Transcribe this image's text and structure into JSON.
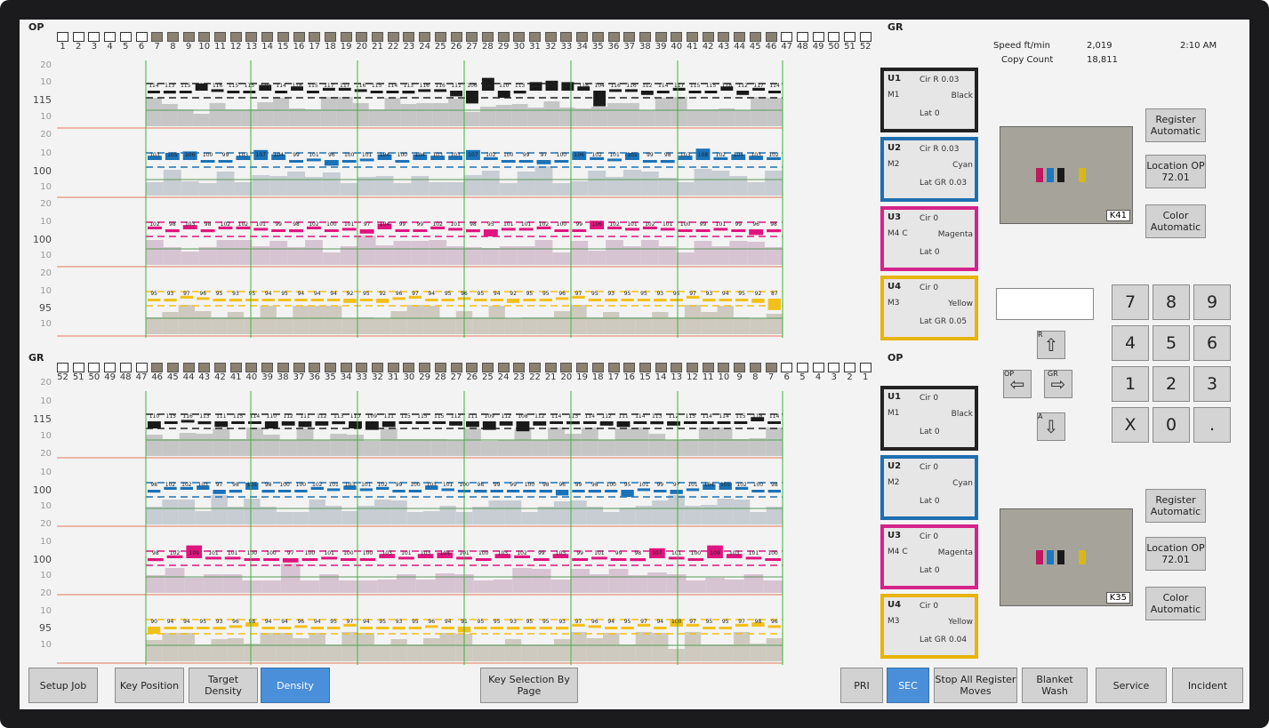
{
  "header": {
    "op_label": "OP",
    "gr_label": "GR",
    "op_label_bottom": "OP",
    "gr_label_bottom": "GR"
  },
  "keys": {
    "top": [
      "1",
      "2",
      "3",
      "4",
      "5",
      "6",
      "7",
      "8",
      "9",
      "10",
      "11",
      "12",
      "13",
      "14",
      "15",
      "16",
      "17",
      "18",
      "19",
      "20",
      "21",
      "22",
      "23",
      "24",
      "25",
      "26",
      "27",
      "28",
      "29",
      "30",
      "31",
      "32",
      "33",
      "34",
      "35",
      "36",
      "37",
      "38",
      "39",
      "40",
      "41",
      "42",
      "43",
      "44",
      "45",
      "46",
      "47",
      "48",
      "49",
      "50",
      "51",
      "52"
    ],
    "bottom": [
      "52",
      "51",
      "50",
      "49",
      "48",
      "47",
      "46",
      "45",
      "44",
      "43",
      "42",
      "41",
      "40",
      "39",
      "38",
      "37",
      "36",
      "35",
      "34",
      "33",
      "32",
      "31",
      "30",
      "29",
      "28",
      "27",
      "26",
      "25",
      "24",
      "23",
      "22",
      "21",
      "20",
      "19",
      "18",
      "17",
      "16",
      "15",
      "14",
      "13",
      "12",
      "11",
      "10",
      "9",
      "8",
      "7",
      "6",
      "5",
      "4",
      "3",
      "2",
      "1"
    ]
  },
  "scale_top": [
    {
      "a": "20",
      "b": "10",
      "c": "115",
      "d": "10",
      "e": "20"
    },
    {
      "a": "10",
      "b": "100",
      "c": "10",
      "d": "20"
    },
    {
      "a": "10",
      "b": "100",
      "c": "10",
      "d": "20"
    },
    {
      "a": "10",
      "b": "95",
      "c": "10",
      "d": "20"
    }
  ],
  "status": {
    "speed_label": "Speed ft/min",
    "speed_value": "2,019",
    "copy_label": "Copy Count",
    "copy_value": "18,811",
    "time": "2:10 AM"
  },
  "units_top": [
    {
      "unit": "U1",
      "m": "M1",
      "cir": "Cir  R 0.03",
      "color": "Black",
      "lat": "Lat   0",
      "border": "#222222"
    },
    {
      "unit": "U2",
      "m": "M2",
      "cir": "Cir  R 0.03",
      "color": "Cyan",
      "lat": "Lat  GR 0.03",
      "border": "#1e6fb0"
    },
    {
      "unit": "U3",
      "m": "M4 C",
      "cir": "Cir    0",
      "color": "Magenta",
      "lat": "Lat   0",
      "border": "#d6238a"
    },
    {
      "unit": "U4",
      "m": "M3",
      "cir": "Cir    0",
      "color": "Yellow",
      "lat": "Lat  GR 0.05",
      "border": "#e8b40a"
    }
  ],
  "units_bottom": [
    {
      "unit": "U1",
      "m": "M1",
      "cir": "Cir    0",
      "color": "Black",
      "lat": "Lat   0",
      "border": "#222222"
    },
    {
      "unit": "U2",
      "m": "M2",
      "cir": "Cir    0",
      "color": "Cyan",
      "lat": "Lat   0",
      "border": "#1e6fb0"
    },
    {
      "unit": "U3",
      "m": "M4 C",
      "cir": "Cir    0",
      "color": "Magenta",
      "lat": "Lat   0",
      "border": "#d6238a"
    },
    {
      "unit": "U4",
      "m": "M3",
      "cir": "Cir    0",
      "color": "Yellow",
      "lat": "Lat  GR 0.04",
      "border": "#e8b40a"
    }
  ],
  "right_top": {
    "register": "Register Automatic",
    "location": "Location OP 72.01",
    "color": "Color Automatic",
    "cam_tag": "K41"
  },
  "right_bottom": {
    "register": "Register Automatic",
    "location": "Location OP 72.01",
    "color": "Color Automatic",
    "cam_tag": "K35"
  },
  "nudge": {
    "r": "R",
    "op": "OP",
    "gr": "GR",
    "a": "A"
  },
  "keypad": [
    "7",
    "8",
    "9",
    "4",
    "5",
    "6",
    "1",
    "2",
    "3",
    "X",
    "0",
    "."
  ],
  "toolbar": {
    "setup_job": "Setup Job",
    "key_position": "Key Position",
    "target_density": "Target Density",
    "density": "Density",
    "key_selection": "Key Selection By Page",
    "pri": "PRI",
    "sec": "SEC",
    "stop_all": "Stop All Register Moves",
    "blanket_wash": "Blanket Wash",
    "service": "Service",
    "incident": "Incident"
  },
  "band_values": {
    "top_black": [
      "114",
      "113",
      "115",
      "120",
      "116",
      "115",
      "115",
      "119",
      "114",
      "118",
      "115",
      "117",
      "117",
      "116",
      "115",
      "114",
      "113",
      "116",
      "116",
      "111",
      "106",
      "124",
      "110",
      "113",
      "121",
      "122",
      "121",
      "118",
      "104",
      "116",
      "116",
      "112",
      "114",
      "117",
      "115",
      "115",
      "118",
      "112",
      "117",
      "114"
    ],
    "top_cyan": [
      "103",
      "105",
      "106",
      "100",
      "99",
      "103",
      "107",
      "104",
      "99",
      "101",
      "96",
      "100",
      "101",
      "104",
      "100",
      "104",
      "103",
      "103",
      "107",
      "102",
      "100",
      "99",
      "97",
      "100",
      "106",
      "102",
      "101",
      "105",
      "99",
      "98",
      "103",
      "108",
      "102",
      "104",
      "103",
      "102"
    ],
    "top_magenta": [
      "102",
      "98",
      "103",
      "98",
      "102",
      "102",
      "101",
      "99",
      "98",
      "102",
      "100",
      "101",
      "97",
      "104",
      "99",
      "99",
      "102",
      "101",
      "98",
      "95",
      "101",
      "101",
      "102",
      "100",
      "99",
      "106",
      "102",
      "101",
      "102",
      "101",
      "100",
      "99",
      "101",
      "99",
      "96",
      "98"
    ],
    "top_yellow": [
      "95",
      "93",
      "97",
      "96",
      "95",
      "93",
      "95",
      "94",
      "95",
      "94",
      "94",
      "94",
      "92",
      "95",
      "92",
      "96",
      "97",
      "94",
      "95",
      "96",
      "95",
      "94",
      "92",
      "95",
      "95",
      "96",
      "97",
      "95",
      "93",
      "95",
      "95",
      "93",
      "95",
      "97",
      "93",
      "94",
      "95",
      "92",
      "87"
    ],
    "bot_black": [
      "110",
      "115",
      "116",
      "113",
      "111",
      "115",
      "114",
      "110",
      "112",
      "111",
      "112",
      "113",
      "110",
      "109",
      "111",
      "115",
      "115",
      "115",
      "112",
      "111",
      "109",
      "112",
      "108",
      "112",
      "114",
      "113",
      "114",
      "112",
      "111",
      "114",
      "113",
      "112",
      "115",
      "114",
      "114",
      "115",
      "118",
      "114"
    ],
    "bot_cyan": [
      "98",
      "102",
      "102",
      "103",
      "97",
      "98",
      "105",
      "98",
      "100",
      "100",
      "102",
      "101",
      "103",
      "101",
      "102",
      "99",
      "100",
      "103",
      "101",
      "100",
      "98",
      "99",
      "99",
      "100",
      "98",
      "96",
      "99",
      "98",
      "100",
      "95",
      "101",
      "99",
      "97",
      "101",
      "104",
      "105",
      "102",
      "100",
      "98"
    ],
    "bot_magenta": [
      "98",
      "102",
      "109",
      "101",
      "101",
      "100",
      "100",
      "97",
      "100",
      "101",
      "100",
      "100",
      "103",
      "101",
      "103",
      "104",
      "101",
      "100",
      "103",
      "102",
      "99",
      "103",
      "99",
      "101",
      "99",
      "98",
      "107",
      "101",
      "100",
      "109",
      "103",
      "101",
      "100"
    ],
    "bot_yellow": [
      "90",
      "94",
      "94",
      "95",
      "93",
      "96",
      "98",
      "94",
      "94",
      "96",
      "94",
      "95",
      "97",
      "94",
      "95",
      "93",
      "95",
      "96",
      "94",
      "91",
      "95",
      "95",
      "93",
      "95",
      "95",
      "93",
      "97",
      "96",
      "94",
      "95",
      "97",
      "94",
      "100",
      "97",
      "95",
      "95",
      "97",
      "98",
      "96"
    ]
  }
}
